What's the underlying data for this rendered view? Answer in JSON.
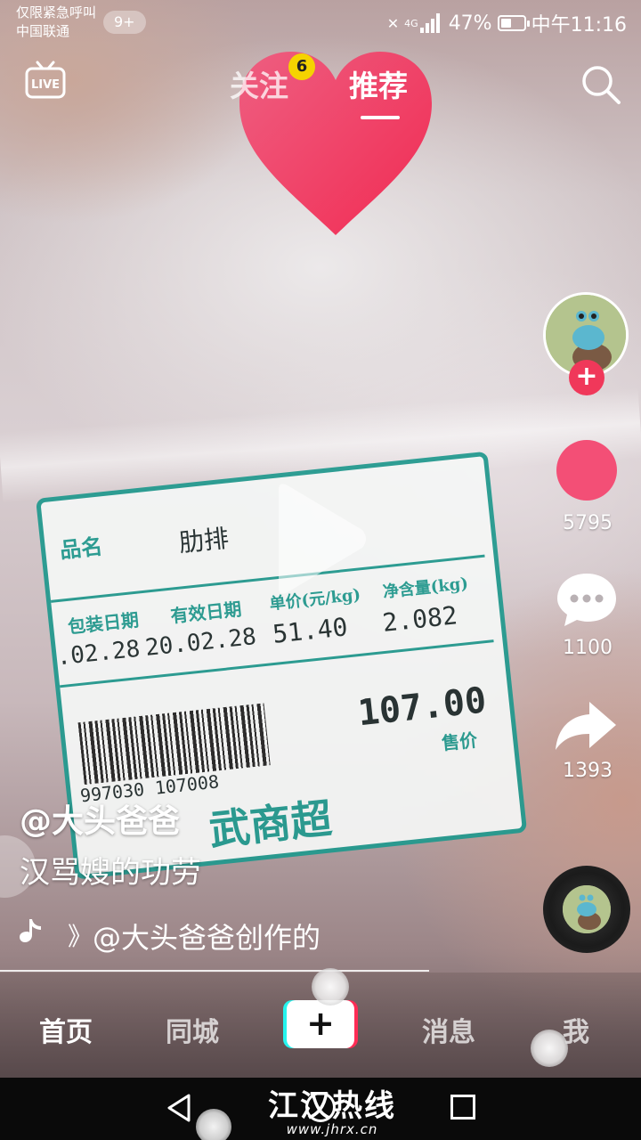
{
  "status_bar": {
    "notice": "仅限紧急呼叫",
    "carrier": "中国联通",
    "notification_badge": "9+",
    "network": "4G",
    "battery_percent": "47%",
    "battery_level": 0.47,
    "time": "中午11:16"
  },
  "top_nav": {
    "live_icon": "live-tv-icon",
    "tabs": [
      {
        "label": "关注",
        "badge": "6",
        "active": false
      },
      {
        "label": "推荐",
        "active": true
      }
    ],
    "search_icon": "search-icon"
  },
  "video_frame": {
    "label_name_title": "品名",
    "label_product": "肋排",
    "label_pack_date_title": "包装日期",
    "label_expiry_title": "有效日期",
    "label_unit_price_title": "单价(元/kg)",
    "label_net_weight_title": "净含量(kg)",
    "label_pack_date": ".02.28",
    "label_expiry": "20.02.28",
    "label_unit_price": "51.40",
    "label_net_weight": "2.082",
    "label_total": "107.00",
    "label_total_title": "售价",
    "label_barcode": "997030 107008",
    "label_store": "武商超"
  },
  "right_rail": {
    "likes": "5795",
    "comments": "1100",
    "shares": "1393",
    "follow_plus": "+",
    "colors": {
      "like": "#f34f76",
      "follow": "#f0385a"
    }
  },
  "post": {
    "author": "@大头爸爸",
    "caption": "汉骂嫂的功劳",
    "music_fragment": "》",
    "music": "@大头爸爸创作的"
  },
  "tab_bar": {
    "items": [
      {
        "label": "首页",
        "active": true
      },
      {
        "label": "同城",
        "active": false
      },
      {
        "label": "+",
        "active": false
      },
      {
        "label": "消息",
        "active": false
      },
      {
        "label": "我",
        "active": false
      }
    ]
  },
  "system_nav": {
    "watermark_main": "江汉热线",
    "watermark_url": "www.jhrx.cn"
  }
}
